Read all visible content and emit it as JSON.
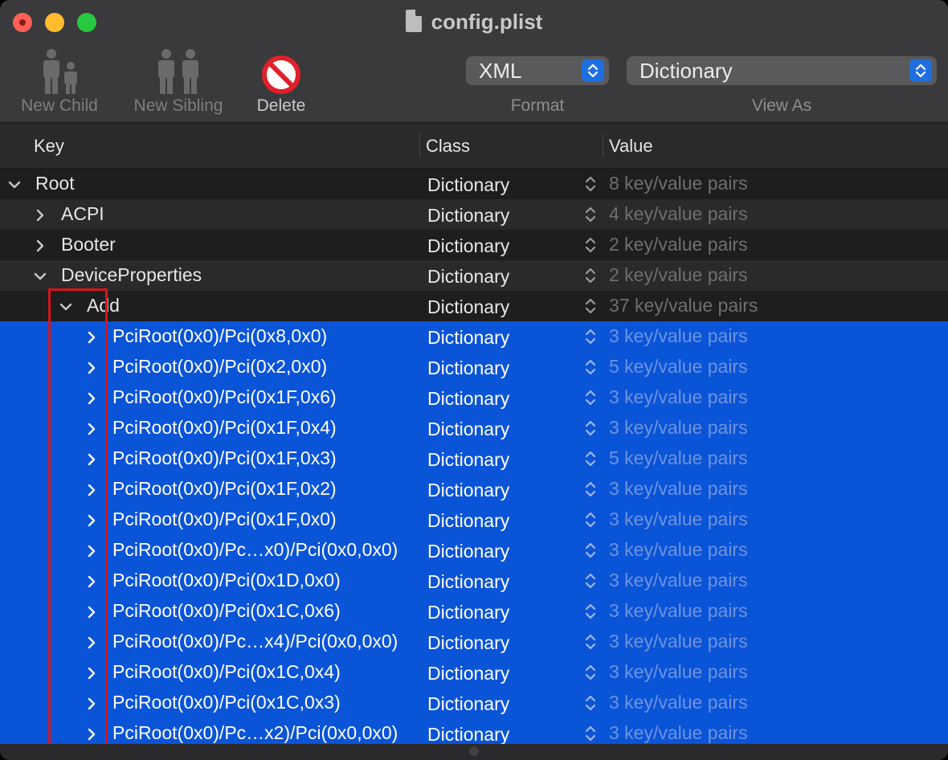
{
  "window": {
    "title": "config.plist"
  },
  "toolbar": {
    "new_child": "New Child",
    "new_sibling": "New Sibling",
    "delete": "Delete",
    "format": {
      "value": "XML",
      "caption": "Format"
    },
    "view_as": {
      "value": "Dictionary",
      "caption": "View As"
    }
  },
  "columns": {
    "key": "Key",
    "class": "Class",
    "value": "Value"
  },
  "rows": [
    {
      "key": "Root",
      "class": "Dictionary",
      "value": "8 key/value pairs",
      "expanded": true,
      "depth": 0
    },
    {
      "key": "ACPI",
      "class": "Dictionary",
      "value": "4 key/value pairs",
      "expanded": false,
      "depth": 1
    },
    {
      "key": "Booter",
      "class": "Dictionary",
      "value": "2 key/value pairs",
      "expanded": false,
      "depth": 1
    },
    {
      "key": "DeviceProperties",
      "class": "Dictionary",
      "value": "2 key/value pairs",
      "expanded": true,
      "depth": 1
    },
    {
      "key": "Add",
      "class": "Dictionary",
      "value": "37 key/value pairs",
      "expanded": true,
      "depth": 2
    },
    {
      "key": "PciRoot(0x0)/Pci(0x8,0x0)",
      "class": "Dictionary",
      "value": "3 key/value pairs",
      "expanded": false,
      "depth": 3,
      "selected": true
    },
    {
      "key": "PciRoot(0x0)/Pci(0x2,0x0)",
      "class": "Dictionary",
      "value": "5 key/value pairs",
      "expanded": false,
      "depth": 3,
      "selected": true
    },
    {
      "key": "PciRoot(0x0)/Pci(0x1F,0x6)",
      "class": "Dictionary",
      "value": "3 key/value pairs",
      "expanded": false,
      "depth": 3,
      "selected": true
    },
    {
      "key": "PciRoot(0x0)/Pci(0x1F,0x4)",
      "class": "Dictionary",
      "value": "3 key/value pairs",
      "expanded": false,
      "depth": 3,
      "selected": true
    },
    {
      "key": "PciRoot(0x0)/Pci(0x1F,0x3)",
      "class": "Dictionary",
      "value": "5 key/value pairs",
      "expanded": false,
      "depth": 3,
      "selected": true
    },
    {
      "key": "PciRoot(0x0)/Pci(0x1F,0x2)",
      "class": "Dictionary",
      "value": "3 key/value pairs",
      "expanded": false,
      "depth": 3,
      "selected": true
    },
    {
      "key": "PciRoot(0x0)/Pci(0x1F,0x0)",
      "class": "Dictionary",
      "value": "3 key/value pairs",
      "expanded": false,
      "depth": 3,
      "selected": true
    },
    {
      "key": "PciRoot(0x0)/Pc…x0)/Pci(0x0,0x0)",
      "class": "Dictionary",
      "value": "3 key/value pairs",
      "expanded": false,
      "depth": 3,
      "selected": true
    },
    {
      "key": "PciRoot(0x0)/Pci(0x1D,0x0)",
      "class": "Dictionary",
      "value": "3 key/value pairs",
      "expanded": false,
      "depth": 3,
      "selected": true
    },
    {
      "key": "PciRoot(0x0)/Pci(0x1C,0x6)",
      "class": "Dictionary",
      "value": "3 key/value pairs",
      "expanded": false,
      "depth": 3,
      "selected": true
    },
    {
      "key": "PciRoot(0x0)/Pc…x4)/Pci(0x0,0x0)",
      "class": "Dictionary",
      "value": "3 key/value pairs",
      "expanded": false,
      "depth": 3,
      "selected": true
    },
    {
      "key": "PciRoot(0x0)/Pci(0x1C,0x4)",
      "class": "Dictionary",
      "value": "3 key/value pairs",
      "expanded": false,
      "depth": 3,
      "selected": true
    },
    {
      "key": "PciRoot(0x0)/Pci(0x1C,0x3)",
      "class": "Dictionary",
      "value": "3 key/value pairs",
      "expanded": false,
      "depth": 3,
      "selected": true
    },
    {
      "key": "PciRoot(0x0)/Pc…x2)/Pci(0x0,0x0)",
      "class": "Dictionary",
      "value": "3 key/value pairs",
      "expanded": false,
      "depth": 3,
      "selected": true
    }
  ],
  "colors": {
    "selection": "#0a54d8",
    "annotation": "#d8141d",
    "accent": "#1f6fe0"
  }
}
